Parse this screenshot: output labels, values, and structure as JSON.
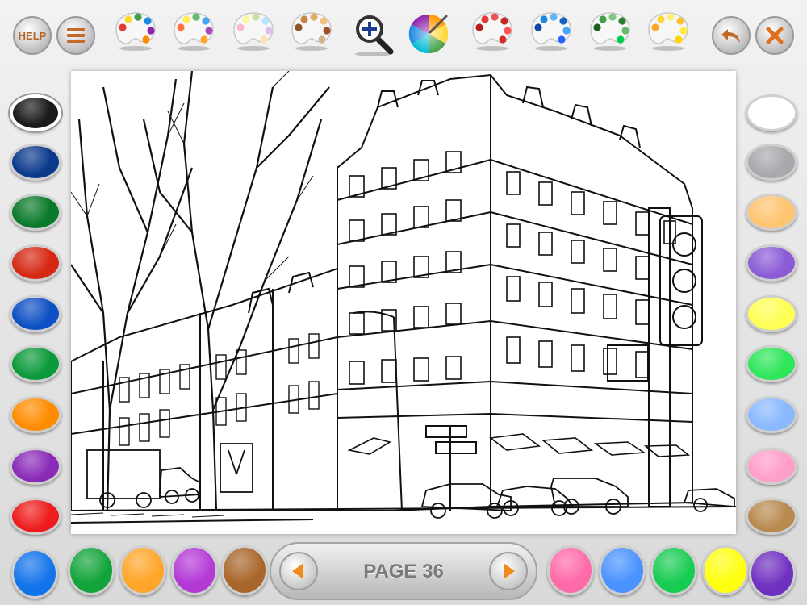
{
  "toolbar": {
    "help_label": "HELP",
    "menu_icon": "menu-icon",
    "zoom_icon": "zoom-in-icon",
    "color_wheel_icon": "color-wheel-icon",
    "undo_icon": "undo-icon",
    "close_icon": "close-icon",
    "palettes": [
      {
        "name": "palette-multicolor-1",
        "dots": [
          "#e53935",
          "#fdd835",
          "#43a047",
          "#1e88e5",
          "#8e24aa",
          "#fb8c00"
        ]
      },
      {
        "name": "palette-multicolor-2",
        "dots": [
          "#ff7043",
          "#ffee58",
          "#66bb6a",
          "#42a5f5",
          "#ab47bc",
          "#ffa726"
        ]
      },
      {
        "name": "palette-pastel",
        "dots": [
          "#f8bbd0",
          "#fff59d",
          "#c5e1a5",
          "#b3e5fc",
          "#e1bee7",
          "#ffe0b2"
        ]
      },
      {
        "name": "palette-browns",
        "dots": [
          "#8d5524",
          "#c68642",
          "#e0ac69",
          "#f1c27d",
          "#a0522d",
          "#d2b48c"
        ]
      },
      {
        "name": "palette-reds",
        "dots": [
          "#b71c1c",
          "#e53935",
          "#ef5350",
          "#c62828",
          "#ff5252",
          "#d32f2f"
        ]
      },
      {
        "name": "palette-blues",
        "dots": [
          "#0d47a1",
          "#1e88e5",
          "#64b5f6",
          "#1565c0",
          "#42a5f5",
          "#2962ff"
        ]
      },
      {
        "name": "palette-greens",
        "dots": [
          "#1b5e20",
          "#43a047",
          "#81c784",
          "#2e7d32",
          "#66bb6a",
          "#00c853"
        ]
      },
      {
        "name": "palette-yellows",
        "dots": [
          "#f9a825",
          "#fdd835",
          "#fff176",
          "#fbc02d",
          "#ffeb3b",
          "#ffd600"
        ]
      }
    ]
  },
  "left_colors": [
    "#1a1a1a",
    "#0b3a8c",
    "#0a7a2a",
    "#d62813",
    "#0d4fc4",
    "#0a9a3a",
    "#ff8c00",
    "#8a2bb8",
    "#ee1c1c"
  ],
  "right_colors": [
    "#ffffff",
    "#a9a9ad",
    "#ffc470",
    "#8b5cd6",
    "#ffff55",
    "#2ee65a",
    "#8ab8ff",
    "#ff9ec8",
    "#b98a50"
  ],
  "bottom_left_colors": [
    "#1273ea",
    "#12a43a",
    "#ffa52a",
    "#b43ad6",
    "#a8662a"
  ],
  "bottom_right_colors": [
    "#ff6aa8",
    "#4a92ff",
    "#18cc52",
    "#ffff10",
    "#7030c0"
  ],
  "selected_color_index": 0,
  "pager": {
    "label": "PAGE 36",
    "prev_icon": "arrow-left-icon",
    "next_icon": "arrow-right-icon"
  },
  "canvas": {
    "subject": "building-street-lineart"
  }
}
